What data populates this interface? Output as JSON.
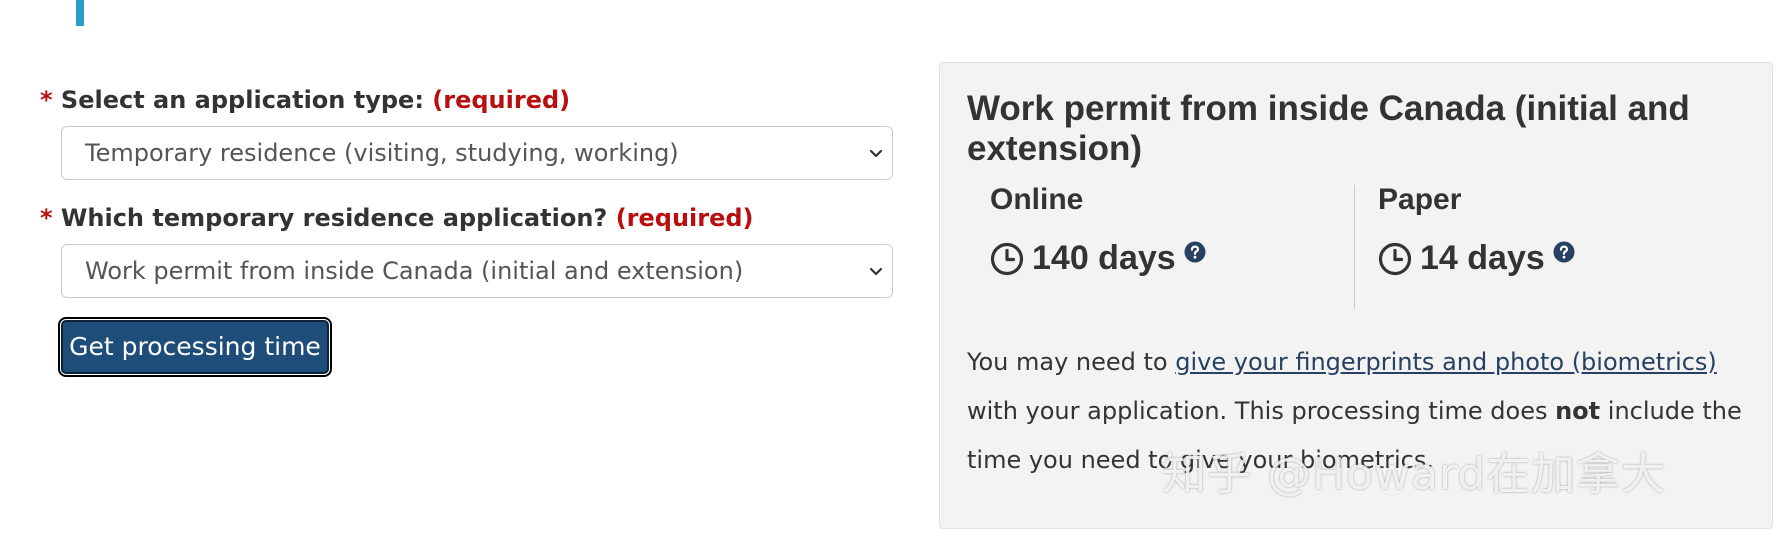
{
  "form": {
    "application_type": {
      "label": "Select an application type:",
      "required_star": "*",
      "required_text": "(required)",
      "selected_value": "Temporary residence (visiting, studying, working)"
    },
    "temporary_residence_application": {
      "label": "Which temporary residence application?",
      "required_star": "*",
      "required_text": "(required)",
      "selected_value": "Work permit from inside Canada (initial and extension)"
    },
    "submit_label": "Get processing time"
  },
  "result": {
    "title": "Work permit from inside Canada (initial and extension)",
    "online": {
      "heading": "Online",
      "time": "140 days"
    },
    "paper": {
      "heading": "Paper",
      "time": "14 days"
    },
    "note": {
      "prefix": "You may need to ",
      "link_text": "give your fingerprints and photo (biometrics)",
      "middle": " with your application. This processing time does ",
      "emphasis": "not",
      "suffix": " include the time you need to give your biometrics."
    }
  },
  "watermark": "知乎 @Howard在加拿大",
  "icons": {
    "chevron": "chevron-down-icon",
    "clock": "clock-icon",
    "help": "question-circle-icon"
  },
  "colors": {
    "accent_bar": "#26a0c4",
    "required": "#b80f0f",
    "button_bg": "#1e4d7a",
    "link": "#284162",
    "panel_bg": "#f3f3f3"
  }
}
